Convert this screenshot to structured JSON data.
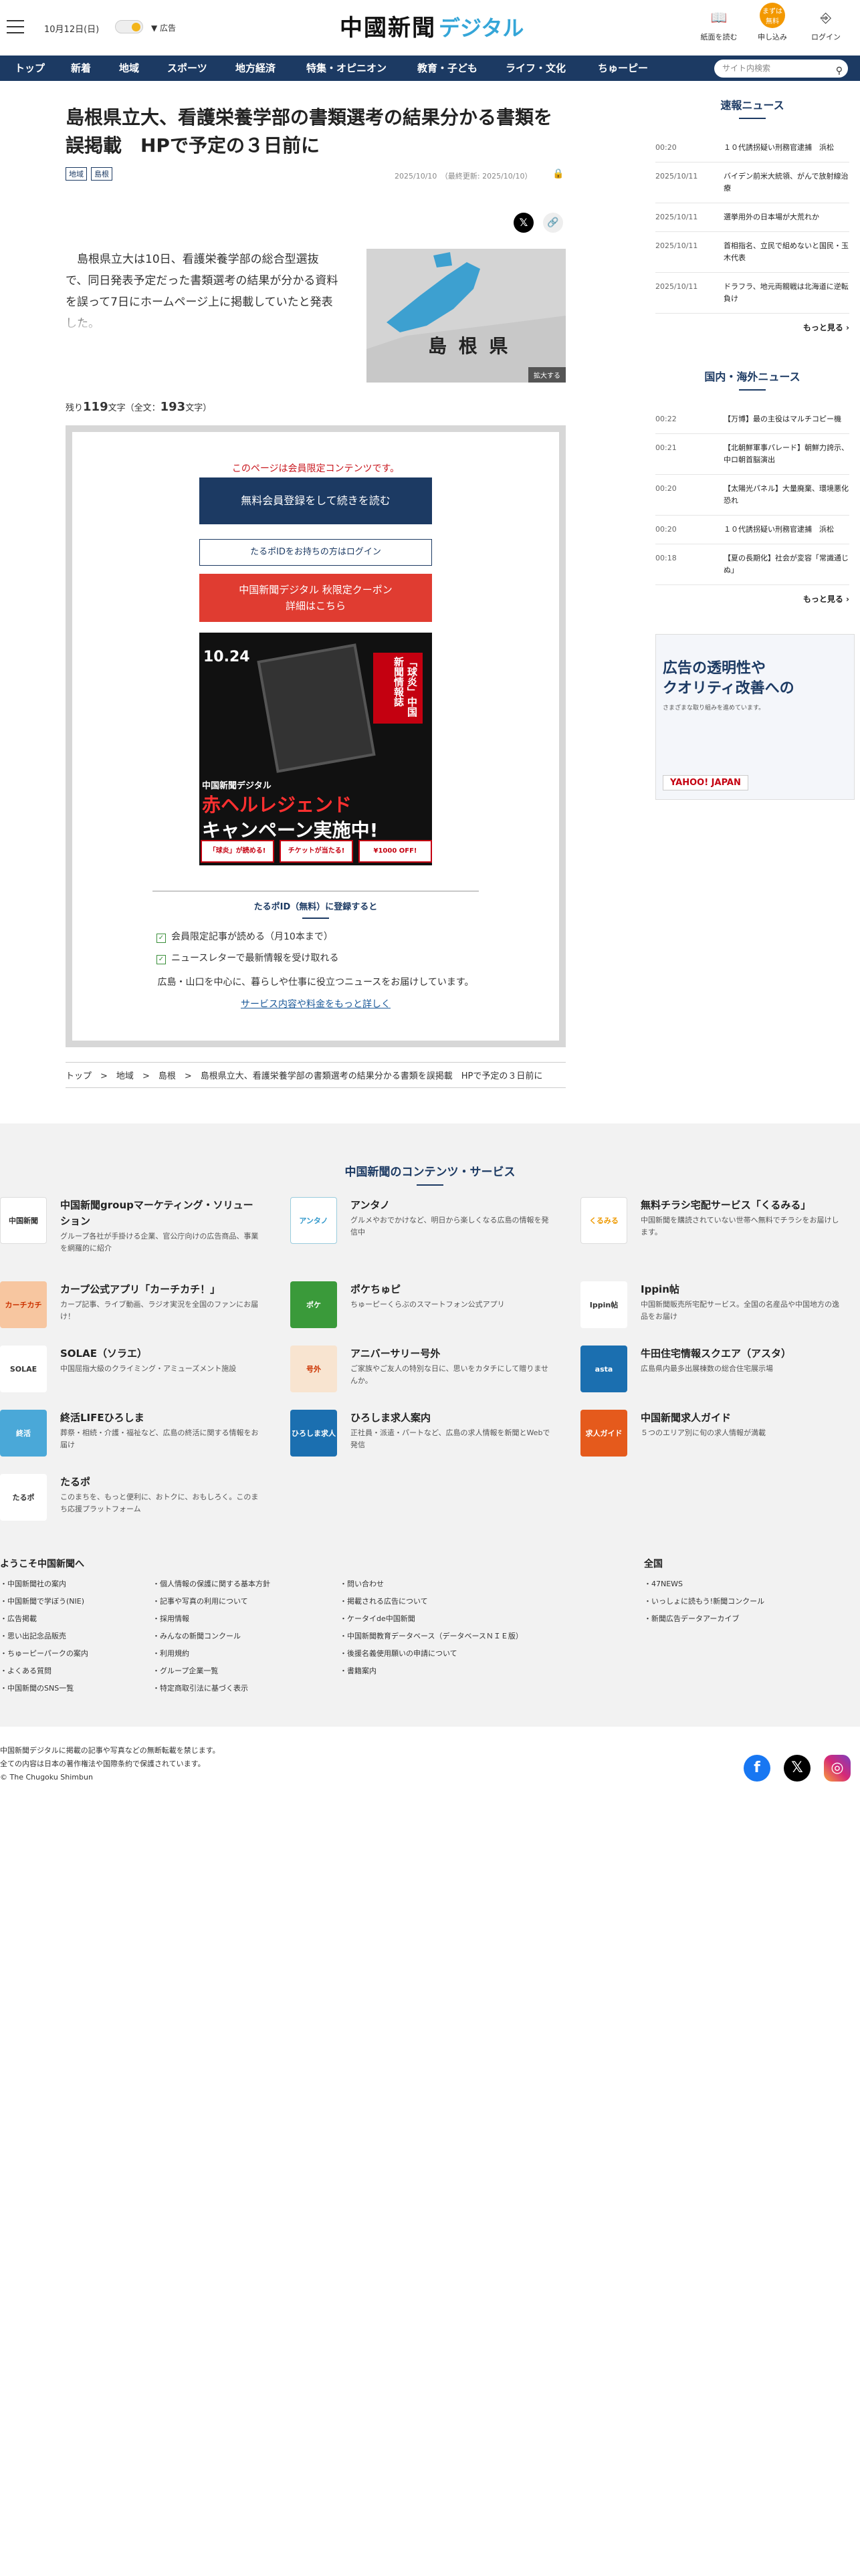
{
  "header": {
    "date": "10月12日(日)",
    "ad_label": "広告",
    "logo_main": "中國新聞",
    "logo_sub": "デジタル",
    "icons": [
      {
        "label": "紙面を読む"
      },
      {
        "label": "申し込み",
        "badge": "まずは無料"
      },
      {
        "label": "ログイン"
      }
    ]
  },
  "nav": {
    "items": [
      "トップ",
      "新着",
      "地域",
      "スポーツ",
      "地方経済",
      "特集・オピニオン",
      "教育・子ども",
      "ライフ・文化",
      "ちゅーピー"
    ],
    "search_placeholder": "サイト内検索"
  },
  "article": {
    "title": "島根県立大、看護栄養学部の書類選考の結果分かる書類を誤掲載　HPで予定の３日前に",
    "tags": [
      "地域",
      "島根"
    ],
    "date": "2025/10/10",
    "updated": "（最終更新: 2025/10/10）",
    "lead": "島根県立大は10日、看護栄養学部の総合型選抜で、同日発表予定だった書類選考の結果が分かる資料を誤って7日にホームページ上に掲載していたと発表した。",
    "map_label": "島 根 県",
    "zoom": "拡大する",
    "remain_prefix": "残り",
    "remain_count": "119",
    "remain_mid": "文字（全文：",
    "total": "193",
    "remain_suffix": "文字）"
  },
  "paywall": {
    "note": "このページは会員限定コンテンツです。",
    "register": "無料会員登録をして続きを読む",
    "login": "たるポIDをお持ちの方はログイン",
    "coupon_line1": "中国新聞デジタル 秋限定クーポン",
    "coupon_line2": "詳細はこちら",
    "promo": {
      "date": "10.24",
      "brand": "中国新聞デジタル",
      "title": "赤ヘルレジェンド",
      "campaign": "キャンペーン実施中!",
      "vertical": "「球炎」中国新聞情報誌",
      "cards": [
        "「球炎」が読める!",
        "チケットが当たる!",
        "¥1000 OFF!"
      ]
    },
    "reg_heading": "たるポID（無料）に登録すると",
    "checks": [
      "会員限定記事が読める（月10本まで）",
      "ニュースレターで最新情報を受け取れる"
    ],
    "reg_text": "広島・山口を中心に、暮らしや仕事に役立つニュースをお届けしています。",
    "more": "サービス内容や料金をもっと詳しく"
  },
  "breadcrumb": [
    "トップ",
    "地域",
    "島根",
    "島根県立大、看護栄養学部の書類選考の結果分かる書類を誤掲載　HPで予定の３日前に"
  ],
  "sidebar": {
    "sokuho": {
      "title": "速報ニュース",
      "rows": [
        {
          "time": "00:20",
          "head": "１０代誘拐疑い刑務官逮捕　浜松"
        },
        {
          "time": "2025/10/11",
          "head": "バイデン前米大統領、がんで放射線治療"
        },
        {
          "time": "2025/10/11",
          "head": "選挙用外の日本場が大荒れか"
        },
        {
          "time": "2025/10/11",
          "head": "首相指名、立民で組めないと国民・玉木代表"
        },
        {
          "time": "2025/10/11",
          "head": "ドラフラ、地元両親戦は北海道に逆転負け"
        }
      ],
      "more": "もっと見る"
    },
    "kokunai": {
      "title": "国内・海外ニュース",
      "rows": [
        {
          "time": "00:22",
          "head": "【万博】最の主役はマルチコピー機"
        },
        {
          "time": "00:21",
          "head": "【北朝鮮軍事パレード】朝鮮力誇示、中ロ朝首脳演出"
        },
        {
          "time": "00:20",
          "head": "【太陽光パネル】大量廃棄、環境悪化恐れ"
        },
        {
          "time": "00:20",
          "head": "１０代誘拐疑い刑務官逮捕　浜松"
        },
        {
          "time": "00:18",
          "head": "【夏の長期化】社会が変容「常識通じぬ」"
        }
      ],
      "more": "もっと見る"
    },
    "ad": {
      "line1": "広告の透明性や",
      "line2": "クオリティ改善への",
      "line3": "さまざまな取り組みを進めています。",
      "brand": "YAHOO! JAPAN"
    }
  },
  "footer": {
    "heading": "中国新聞のコンテンツ・サービス",
    "services": [
      {
        "name": "中国新聞groupマーケティング・ソリューション",
        "desc": "グループ各社が手掛ける企業、官公庁向けの広告商品、事業を網羅的に紹介"
      },
      {
        "name": "アンタノ",
        "desc": "グルメやおでかけなど、明日から楽しくなる広島の情報を発信中"
      },
      {
        "name": "無料チラシ宅配サービス「くるみる」",
        "desc": "中国新聞を購読されていない世帯へ無料でチラシをお届けします。"
      },
      {
        "name": "カープ公式アプリ「カーチカチ！」",
        "desc": "カープ記事、ライブ動画、ラジオ実況を全国のファンにお届け！"
      },
      {
        "name": "ポケちゅピ",
        "desc": "ちゅーピーくらぶのスマートフォン公式アプリ"
      },
      {
        "name": "Ippin帖",
        "desc": "中国新聞販売所宅配サービス。全国の名産品や中国地方の逸品をお届け"
      },
      {
        "name": "SOLAE（ソラエ）",
        "desc": "中国屈指大級のクライミング・アミューズメント施設"
      },
      {
        "name": "アニバーサリー号外",
        "desc": "ご家族やご友人の特別な日に、思いをカタチにして贈りませんか。"
      },
      {
        "name": "牛田住宅情報スクエア（アスタ）",
        "desc": "広島県内最多出展棟数の総合住宅展示場"
      },
      {
        "name": "終活LIFEひろしま",
        "desc": "葬祭・相続・介護・福祉など、広島の終活に関する情報をお届け"
      },
      {
        "name": "ひろしま求人案内",
        "desc": "正社員・派遣・パートなど、広島の求人情報を新聞とWebで発信"
      },
      {
        "name": "中国新聞求人ガイド",
        "desc": "５つのエリア別に旬の求人情報が満載"
      },
      {
        "name": "たるポ",
        "desc": "このまちを、もっと便利に、おトクに、おもしろく。このまち応援プラットフォーム"
      }
    ],
    "welcome": "ようこそ中国新聞へ",
    "zenkoku": "全国",
    "col1": [
      "中国新聞社の案内",
      "中国新聞で学ぼう(NIE)",
      "広告掲載",
      "思い出記念品販売",
      "ちゅーピーパークの案内",
      "よくある質問",
      "中国新聞のSNS一覧"
    ],
    "col2": [
      "個人情報の保護に関する基本方針",
      "記事や写真の利用について",
      "採用情報",
      "みんなの新聞コンクール",
      "利用規約",
      "グループ企業一覧",
      "特定商取引法に基づく表示"
    ],
    "col3": [
      "問い合わせ",
      "掲載される広告について",
      "ケータイde中国新聞",
      "中国新聞教育データベース（データベースＮＩＥ版）",
      "後援名義使用願いの申請について",
      "書籍案内"
    ],
    "col4": [
      "47NEWS",
      "いっしょに読もう!新聞コンクール",
      "新聞広告データアーカイブ"
    ],
    "copy1": "中国新聞デジタルに掲載の記事や写真などの無断転載を禁じます。",
    "copy2": "全ての内容は日本の著作権法や国際条約で保護されています。",
    "copy3": "© The Chugoku Shimbun"
  }
}
